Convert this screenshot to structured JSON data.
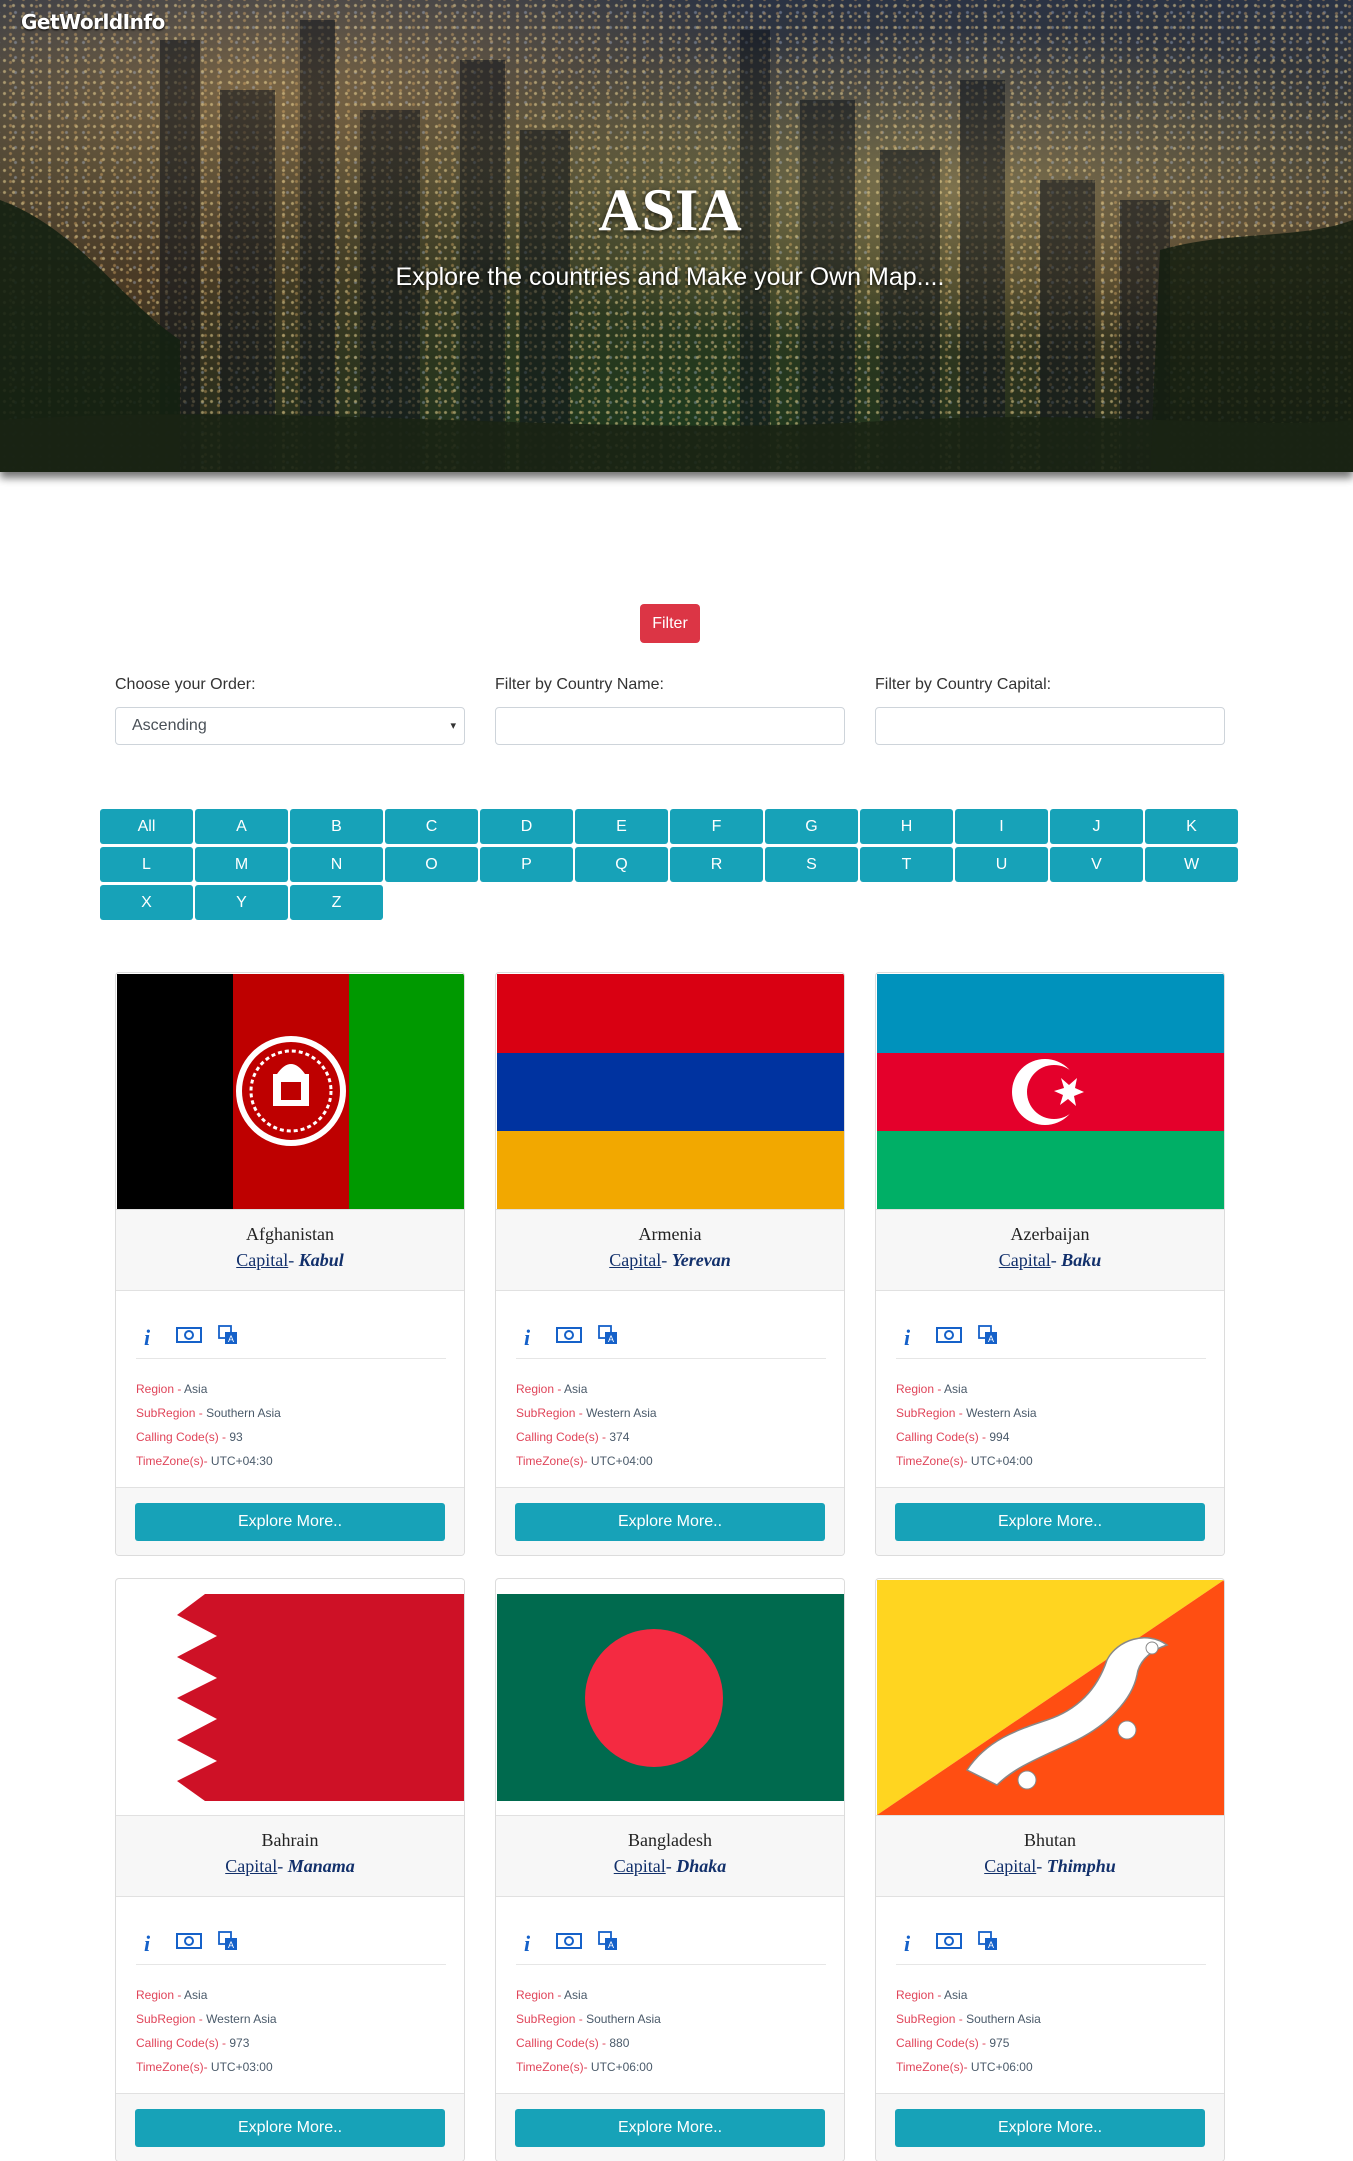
{
  "header": {
    "brand": "GetWorldInfo",
    "title": "ASIA",
    "subtitle": "Explore the countries and Make your Own Map...."
  },
  "filters": {
    "button_label": "Filter",
    "order_label": "Choose your Order:",
    "order_value": "Ascending",
    "name_label": "Filter by Country Name:",
    "capital_label": "Filter by Country Capital:"
  },
  "letters": [
    "All",
    "A",
    "B",
    "C",
    "D",
    "E",
    "F",
    "G",
    "H",
    "I",
    "J",
    "K",
    "L",
    "M",
    "N",
    "O",
    "P",
    "Q",
    "R",
    "S",
    "T",
    "U",
    "V",
    "W",
    "X",
    "Y",
    "Z"
  ],
  "card_labels": {
    "capital": "Capital",
    "region": "Region",
    "subregion": "SubRegion",
    "calling": "Calling Code(s)",
    "timezone": "TimeZone(s)",
    "explore": "Explore More.."
  },
  "icons": [
    "info-icon",
    "currency-icon",
    "language-icon"
  ],
  "countries": [
    {
      "name": "Afghanistan",
      "capital": "Kabul",
      "region": "Asia",
      "subregion": "Southern Asia",
      "calling": "93",
      "timezone": "UTC+04:30",
      "flag": "afghanistan"
    },
    {
      "name": "Armenia",
      "capital": "Yerevan",
      "region": "Asia",
      "subregion": "Western Asia",
      "calling": "374",
      "timezone": "UTC+04:00",
      "flag": "armenia"
    },
    {
      "name": "Azerbaijan",
      "capital": "Baku",
      "region": "Asia",
      "subregion": "Western Asia",
      "calling": "994",
      "timezone": "UTC+04:00",
      "flag": "azerbaijan"
    },
    {
      "name": "Bahrain",
      "capital": "Manama",
      "region": "Asia",
      "subregion": "Western Asia",
      "calling": "973",
      "timezone": "UTC+03:00",
      "flag": "bahrain"
    },
    {
      "name": "Bangladesh",
      "capital": "Dhaka",
      "region": "Asia",
      "subregion": "Southern Asia",
      "calling": "880",
      "timezone": "UTC+06:00",
      "flag": "bangladesh"
    },
    {
      "name": "Bhutan",
      "capital": "Thimphu",
      "region": "Asia",
      "subregion": "Southern Asia",
      "calling": "975",
      "timezone": "UTC+06:00",
      "flag": "bhutan"
    }
  ],
  "colors": {
    "accent": "#17a2b8",
    "danger": "#dc3545",
    "label_red": "#e0455a",
    "capital_blue": "#12306b",
    "icon_blue": "#1561c9"
  }
}
